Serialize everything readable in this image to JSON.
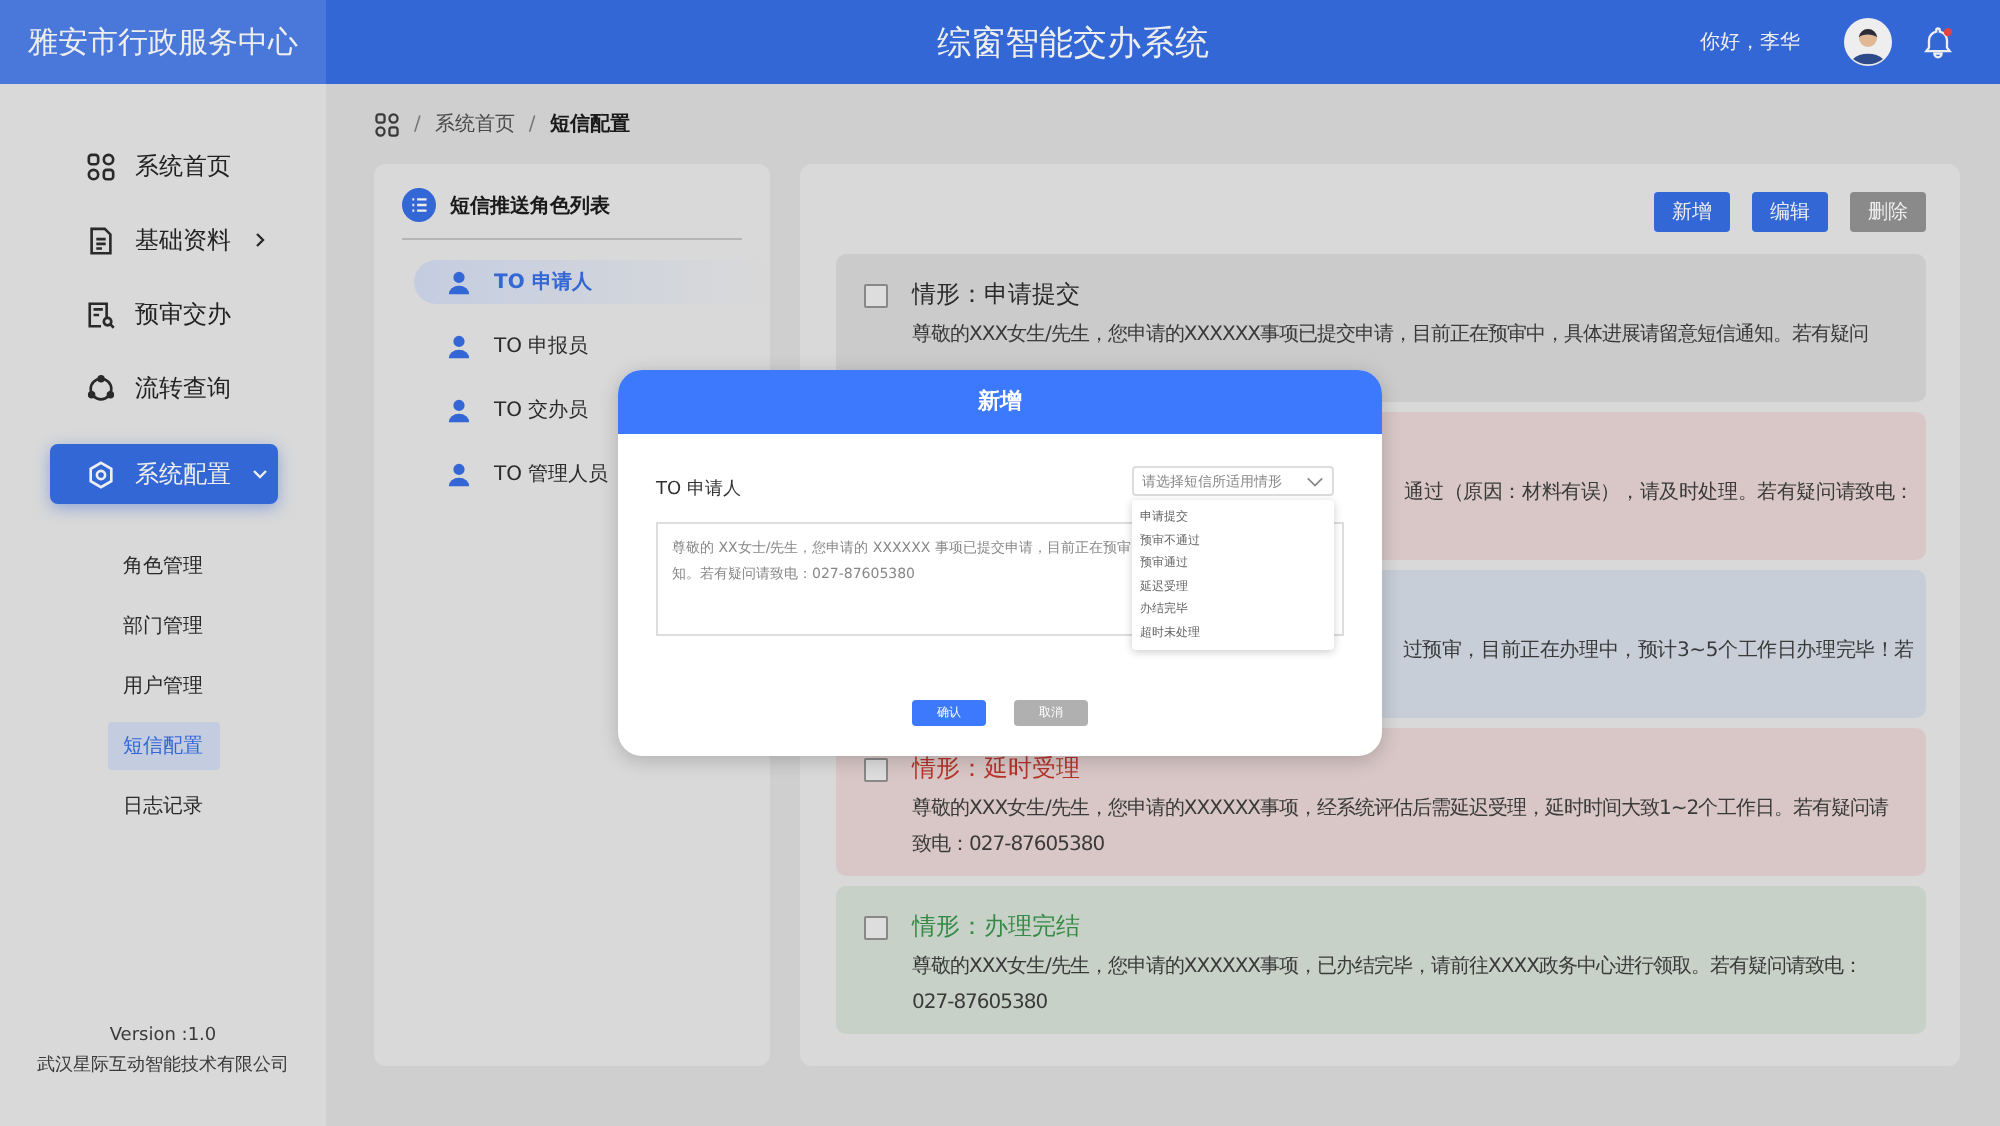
{
  "header": {
    "org": "雅安市行政服务中心",
    "title": "综窗智能交办系统",
    "greeting": "你好，李华",
    "notification_dot": true
  },
  "sidebar": {
    "items": [
      {
        "label": "系统首页",
        "has_arrow": false,
        "selected": false
      },
      {
        "label": "基础资料",
        "has_arrow": true,
        "expanded": false,
        "selected": false
      },
      {
        "label": "预审交办",
        "has_arrow": false,
        "selected": false
      },
      {
        "label": "流转查询",
        "has_arrow": false,
        "selected": false
      },
      {
        "label": "系统配置",
        "has_arrow": true,
        "expanded": true,
        "selected": true,
        "children": [
          {
            "label": "角色管理",
            "selected": false
          },
          {
            "label": "部门管理",
            "selected": false
          },
          {
            "label": "用户管理",
            "selected": false
          },
          {
            "label": "短信配置",
            "selected": true
          },
          {
            "label": "日志记录",
            "selected": false
          }
        ]
      }
    ],
    "version": "Version :1.0",
    "company": "武汉星际互动智能技术有限公司"
  },
  "breadcrumb": {
    "separator": "/",
    "items": [
      "系统首页",
      "短信配置"
    ]
  },
  "roles": {
    "title": "短信推送角色列表",
    "items": [
      {
        "label": "TO 申请人",
        "selected": true
      },
      {
        "label": "TO 申报员",
        "selected": false
      },
      {
        "label": "TO 交办员",
        "selected": false
      },
      {
        "label": "TO 管理人员",
        "selected": false
      }
    ]
  },
  "toolbar": [
    {
      "label": "新增",
      "disabled": false
    },
    {
      "label": "编辑",
      "disabled": false
    },
    {
      "label": "删除",
      "disabled": true
    }
  ],
  "cards": [
    {
      "kind": "plain",
      "title": "情形：申请提交",
      "text": "尊敬的XXX女生/先生，您申请的XXXXXX事项已提交申请，目前正在预审中，具体进展请留意短信通知。若有疑问",
      "color": "#cbcbcb",
      "checked": false
    },
    {
      "kind": "covered",
      "text": "通过（原因：材料有误），请及时处理。若有疑问请致电：",
      "color": "#d9c7c7"
    },
    {
      "kind": "covered",
      "text": "过预审，目前正在办理中，预计3~5个工作日办理完毕！若",
      "color": "#c7ced8"
    },
    {
      "kind": "alert",
      "title": "情形：延时受理",
      "text": "尊敬的XXX女生/先生，您申请的XXXXXX事项，经系统评估后需延迟受理，延时时间大致1~2个工作日。若有疑问请致电：027-87605380",
      "color": "#d9c7c7",
      "checked": false
    },
    {
      "kind": "success",
      "title": "情形：办理完结",
      "text": "尊敬的XXX女生/先生，您申请的XXXXXX事项，已办结完毕，请前往XXXX政务中心进行领取。若有疑问请致电：027-87605380",
      "color": "#c7d1c8",
      "checked": false
    }
  ],
  "modal": {
    "title": "新增",
    "role": "TO 申请人",
    "select_placeholder": "请选择短信所适用情形",
    "options": [
      "申请提交",
      "预审不通过",
      "预审通过",
      "延迟受理",
      "办结完毕",
      "超时未处理"
    ],
    "message": "尊敬的 XX女士/先生，您申请的 XXXXXX 事项已提交申请，目前正在预审",
    "message_line2": "知。若有疑问请致电：027-87605380",
    "buttons": [
      {
        "label": "确认",
        "kind": "primary"
      },
      {
        "label": "取消",
        "kind": "secondary"
      }
    ]
  }
}
